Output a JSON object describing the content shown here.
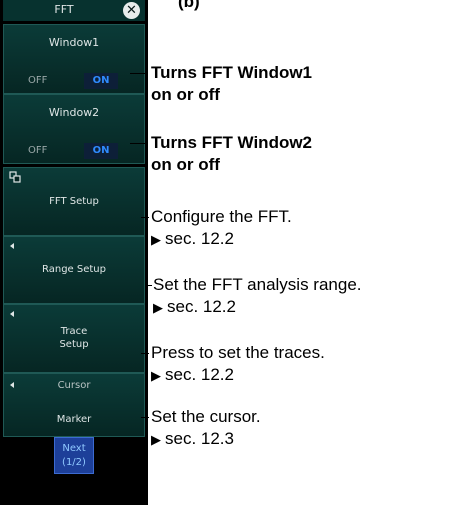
{
  "caption_fragment": "(b)",
  "menu": {
    "title": "FFT",
    "window1": {
      "label": "Window1",
      "off": "OFF",
      "on": "ON"
    },
    "window2": {
      "label": "Window2",
      "off": "OFF",
      "on": "ON"
    },
    "fft_setup": "FFT Setup",
    "range_setup": "Range Setup",
    "trace_setup_line1": "Trace",
    "trace_setup_line2": "Setup",
    "cursor": {
      "label": "Cursor",
      "value": "Marker"
    },
    "next": {
      "line1": "Next",
      "line2": "(1/2)"
    }
  },
  "callouts": {
    "window1": {
      "line1": "Turns FFT Window1",
      "line2": "on or off"
    },
    "window2": {
      "line1": "Turns FFT Window2",
      "line2": "on or off"
    },
    "fft_setup": {
      "line1": "Configure the FFT.",
      "line2": "sec. 12.2"
    },
    "range_setup": {
      "line1": "Set the FFT analysis range.",
      "line2": "sec. 12.2"
    },
    "trace_setup": {
      "line1": "Press to set the traces.",
      "line2": "sec. 12.2"
    },
    "cursor": {
      "line1": "Set the cursor.",
      "line2": "sec. 12.3"
    }
  },
  "icons": {
    "close": "close-icon",
    "setup": "setup-icon",
    "submenu_arrow": "left-arrow-icon"
  },
  "colors": {
    "panel": "#000000",
    "button": "#0b3b38",
    "on_highlight": "#2f8bff",
    "next_button": "#1d3f99"
  }
}
